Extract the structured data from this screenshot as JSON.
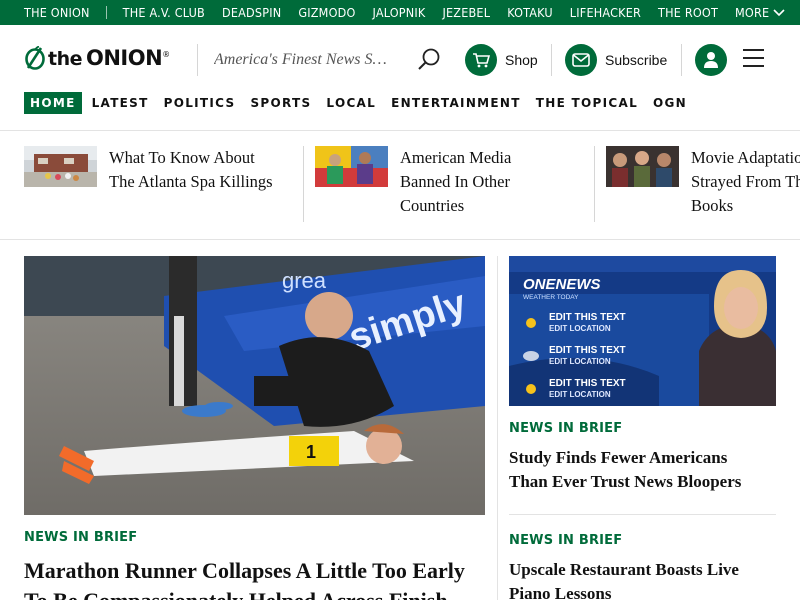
{
  "network_bar": {
    "links": [
      "THE ONION",
      "THE A.V. CLUB",
      "DEADSPIN",
      "GIZMODO",
      "JALOPNIK",
      "JEZEBEL",
      "KOTAKU",
      "LIFEHACKER",
      "THE ROOT",
      "MORE"
    ],
    "color": "#006b3a"
  },
  "header": {
    "logo_the": "the",
    "logo_onion": "ONION",
    "logo_mark": "®",
    "tagline": "America's Finest News Source",
    "shop_label": "Shop",
    "subscribe_label": "Subscribe"
  },
  "nav": {
    "items": [
      "HOME",
      "LATEST",
      "POLITICS",
      "SPORTS",
      "LOCAL",
      "ENTERTAINMENT",
      "THE TOPICAL",
      "OGN"
    ],
    "active": "HOME"
  },
  "trending": [
    {
      "line1": "What To Know About",
      "line2": "The Atlanta Spa Killings",
      "line3": ""
    },
    {
      "line1": "American Media",
      "line2": "Banned In Other",
      "line3": "Countries"
    },
    {
      "line1": "Movie Adaptations",
      "line2": "Strayed From The",
      "line3": "Books"
    }
  ],
  "hero": {
    "kicker": "NEWS IN BRIEF",
    "title_line1": "Marathon Runner Collapses A Little Too Early",
    "title_line2": "To Be Compassionately Helped Across Finish",
    "image_bib": "1",
    "image_banner": "simply",
    "image_banner2": "grea"
  },
  "side": {
    "image": {
      "brand": "ONENEWS",
      "subbrand": "WEATHER TODAY",
      "rows": [
        {
          "title": "EDIT THIS TEXT",
          "sub": "EDIT LOCATION"
        },
        {
          "title": "EDIT THIS TEXT",
          "sub": "EDIT LOCATION"
        },
        {
          "title": "EDIT THIS TEXT",
          "sub": "EDIT LOCATION"
        }
      ]
    },
    "stories": [
      {
        "kicker": "NEWS IN BRIEF",
        "line1": "Study Finds Fewer Americans",
        "line2": "Than Ever Trust News Bloopers"
      },
      {
        "kicker": "NEWS IN BRIEF",
        "line1": "Upscale Restaurant Boasts Live",
        "line2": "Piano Lessons"
      }
    ]
  },
  "colors": {
    "brand_green": "#006b3a",
    "divider": "#e3e3e3"
  }
}
